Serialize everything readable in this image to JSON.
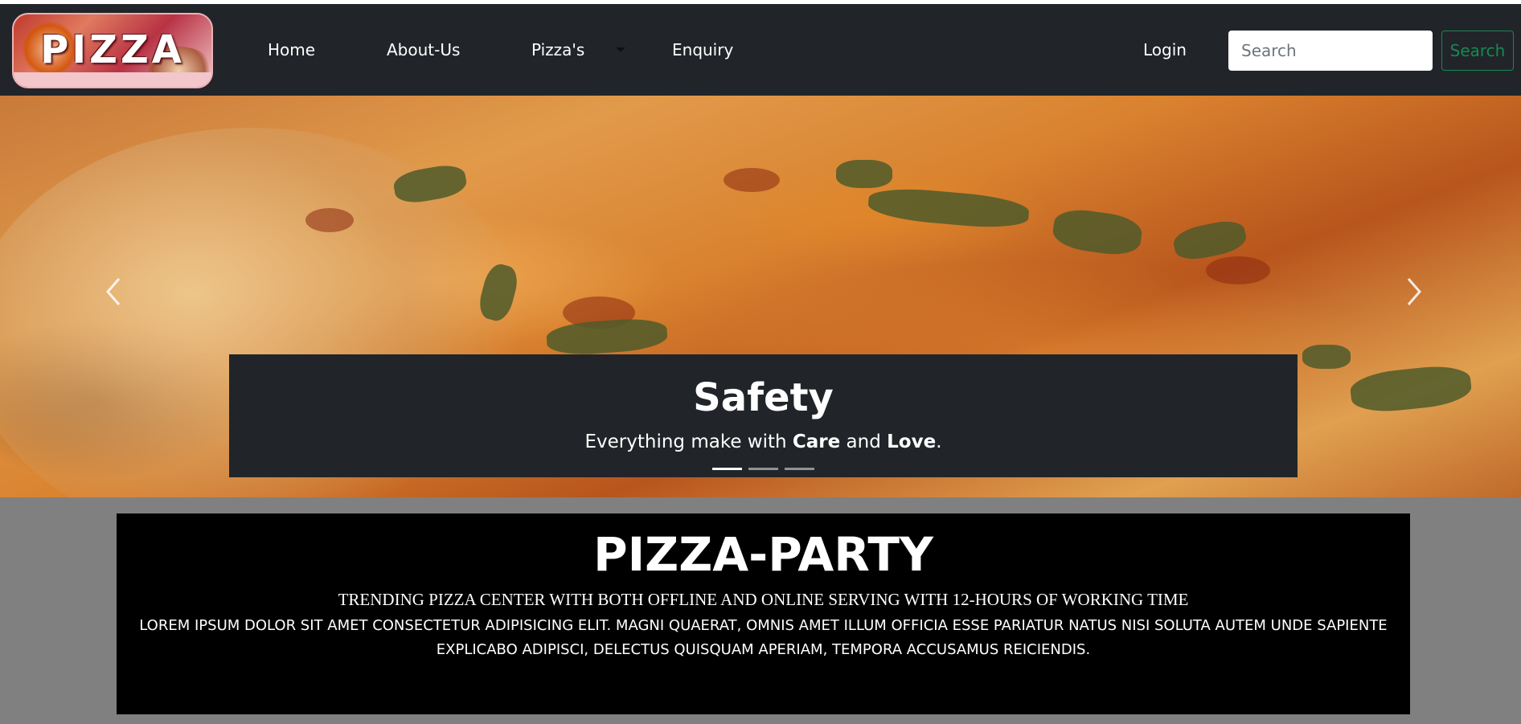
{
  "navbar": {
    "logo_text": "PIZZA",
    "links": {
      "home": "Home",
      "about": "About-Us",
      "pizzas": "Pizza's",
      "enquiry": "Enquiry",
      "login": "Login"
    },
    "search": {
      "placeholder": "Search",
      "button_label": "Search"
    }
  },
  "carousel": {
    "caption_title": "Safety",
    "caption_text": {
      "prefix": "Everything make with ",
      "care": "Care",
      "and": " and ",
      "love": "Love",
      "suffix": "."
    },
    "slide_count": 3,
    "active_index": 0
  },
  "info": {
    "title": "PIZZA-PARTY",
    "subtitle": "TRENDING PIZZA CENTER WITH BOTH OFFLINE AND ONLINE SERVING WITH 12-HOURS OF WORKING TIME",
    "body": "LOREM IPSUM DOLOR SIT AMET CONSECTETUR ADIPISICING ELIT. MAGNI QUAERAT, OMNIS AMET ILLUM OFFICIA ESSE PARIATUR NATUS NISI SOLUTA AUTEM UNDE SAPIENTE EXPLICABO ADIPISCI, DELECTUS QUISQUAM APERIAM, TEMPORA ACCUSAMUS REICIENDIS."
  },
  "colors": {
    "navbar_bg": "#212529",
    "search_button": "#198754",
    "page_bg": "#808080",
    "info_bg": "#000000"
  },
  "icons": [
    "chevron-left-icon",
    "chevron-right-icon",
    "caret-down-icon"
  ]
}
